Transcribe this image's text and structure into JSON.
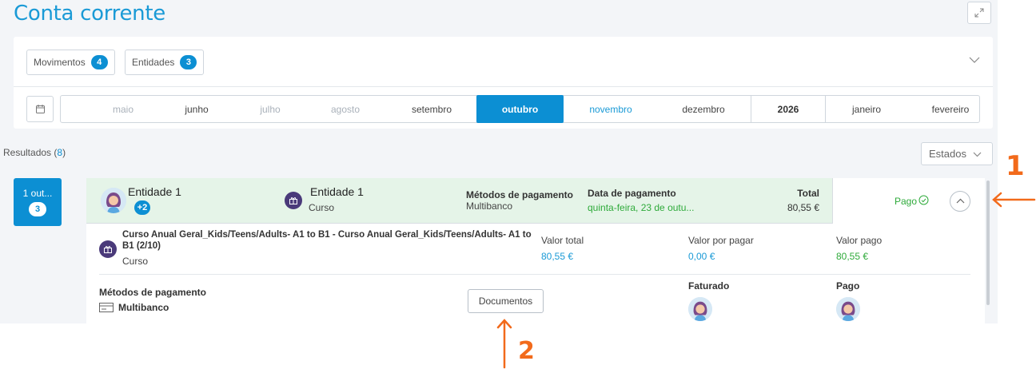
{
  "page": {
    "title": "Conta corrente"
  },
  "filters": {
    "movimentos": {
      "label": "Movimentos",
      "count": "4"
    },
    "entidades": {
      "label": "Entidades",
      "count": "3"
    }
  },
  "months": {
    "items": [
      "maio",
      "junho",
      "julho",
      "agosto",
      "setembro",
      "outubro",
      "novembro",
      "dezembro",
      "2026",
      "janeiro",
      "fevereiro"
    ],
    "selected": "outubro"
  },
  "results": {
    "label": "Resultados (",
    "count": "8",
    "close": ")"
  },
  "estados": {
    "label": "Estados"
  },
  "date_tile": {
    "label": "1 out...",
    "count": "3"
  },
  "entry": {
    "entity_name": "Entidade 1",
    "more_count": "+2",
    "product_name": "Entidade 1",
    "product_type": "Curso",
    "methods_label": "Métodos de pagamento",
    "methods_value": "Multibanco",
    "date_label": "Data de pagamento",
    "date_value": "quinta-feira, 23 de outu...",
    "total_label": "Total",
    "total_value": "80,55 €",
    "status": "Pago"
  },
  "detail": {
    "course_title_line1": "Curso Anual Geral_Kids/Teens/Adults- A1 to B1 - Curso Anual Geral_Kids/Teens/Adults- A1 to",
    "course_title_line2": "B1 (2/10)",
    "course_type": "Curso",
    "valor_total_label": "Valor total",
    "valor_total": "80,55 €",
    "valor_por_pagar_label": "Valor por pagar",
    "valor_por_pagar": "0,00 €",
    "valor_pago_label": "Valor pago",
    "valor_pago": "80,55 €",
    "methods_label": "Métodos de pagamento",
    "methods_value": "Multibanco",
    "documentos": "Documentos",
    "faturado_label": "Faturado",
    "pago_label": "Pago"
  },
  "annotations": {
    "one": "1",
    "two": "2",
    "color": "#f26a1b"
  }
}
